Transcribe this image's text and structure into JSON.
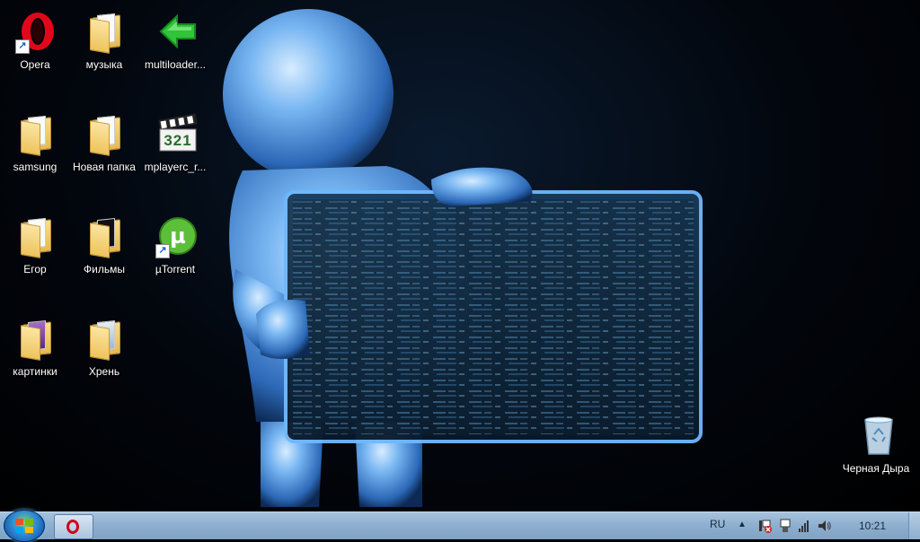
{
  "desktop": {
    "icons": [
      {
        "label": "Opera",
        "icon": "opera-icon"
      },
      {
        "label": "музыка",
        "icon": "folder-icon"
      },
      {
        "label": "multiloader...",
        "icon": "green-arrow-icon"
      },
      {
        "label": "samsung",
        "icon": "folder-icon"
      },
      {
        "label": "Новая папка",
        "icon": "folder-icon"
      },
      {
        "label": "mplayerc_r...",
        "icon": "media-player-icon"
      },
      {
        "label": "Егор",
        "icon": "folder-icon"
      },
      {
        "label": "Фильмы",
        "icon": "folder-icon"
      },
      {
        "label": "µTorrent",
        "icon": "utorrent-icon"
      },
      {
        "label": "картинки",
        "icon": "folder-icon"
      },
      {
        "label": "Хрень",
        "icon": "folder-icon"
      }
    ],
    "recycle_bin": {
      "label": "Черная Дыра",
      "icon": "recycle-bin-icon"
    },
    "media_player_badge": "321"
  },
  "taskbar": {
    "start_icon": "windows-logo-icon",
    "pinned": [
      {
        "name": "Opera",
        "icon": "opera-icon"
      }
    ],
    "tray": {
      "language": "RU",
      "show_hidden": "▲",
      "clock": "10:21",
      "icons": [
        "network-error-icon",
        "usb-icon",
        "signal-icon",
        "volume-icon"
      ]
    }
  },
  "colors": {
    "accent": "#4fa3ff",
    "taskbar": "#8fb0d0"
  }
}
